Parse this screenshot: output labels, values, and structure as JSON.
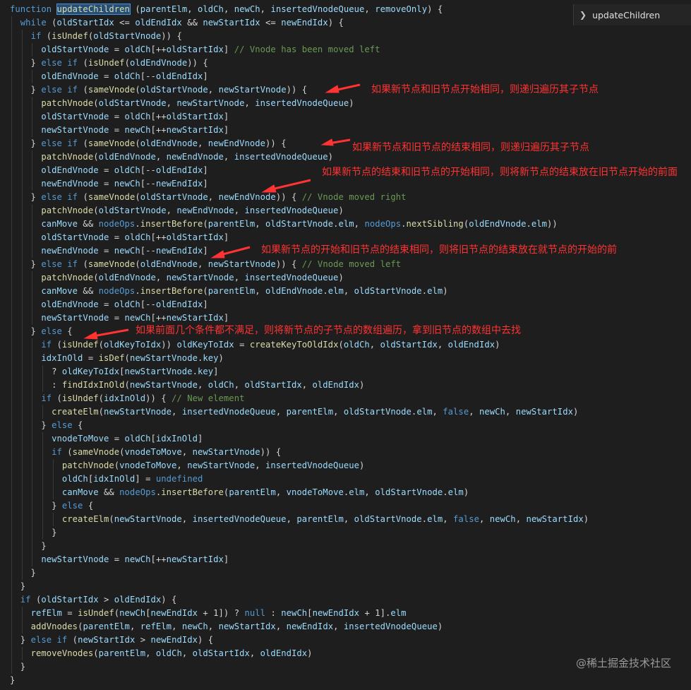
{
  "outline": {
    "label": "updateChildren"
  },
  "code": [
    "function updateChildren (parentElm, oldCh, newCh, insertedVnodeQueue, removeOnly) {",
    "  while (oldStartIdx <= oldEndIdx && newStartIdx <= newEndIdx) {",
    "    if (isUndef(oldStartVnode)) {",
    "      oldStartVnode = oldCh[++oldStartIdx] // Vnode has been moved left",
    "    } else if (isUndef(oldEndVnode)) {",
    "      oldEndVnode = oldCh[--oldEndIdx]",
    "    } else if (sameVnode(oldStartVnode, newStartVnode)) {",
    "      patchVnode(oldStartVnode, newStartVnode, insertedVnodeQueue)",
    "      oldStartVnode = oldCh[++oldStartIdx]",
    "      newStartVnode = newCh[++newStartIdx]",
    "    } else if (sameVnode(oldEndVnode, newEndVnode)) {",
    "      patchVnode(oldEndVnode, newEndVnode, insertedVnodeQueue)",
    "      oldEndVnode = oldCh[--oldEndIdx]",
    "      newEndVnode = newCh[--newEndIdx]",
    "    } else if (sameVnode(oldStartVnode, newEndVnode)) { // Vnode moved right",
    "      patchVnode(oldStartVnode, newEndVnode, insertedVnodeQueue)",
    "      canMove && nodeOps.insertBefore(parentElm, oldStartVnode.elm, nodeOps.nextSibling(oldEndVnode.elm))",
    "      oldStartVnode = oldCh[++oldStartIdx]",
    "      newEndVnode = newCh[--newEndIdx]",
    "    } else if (sameVnode(oldEndVnode, newStartVnode)) { // Vnode moved left",
    "      patchVnode(oldEndVnode, newStartVnode, insertedVnodeQueue)",
    "      canMove && nodeOps.insertBefore(parentElm, oldEndVnode.elm, oldStartVnode.elm)",
    "      oldEndVnode = oldCh[--oldEndIdx]",
    "      newStartVnode = newCh[++newStartIdx]",
    "    } else {",
    "      if (isUndef(oldKeyToIdx)) oldKeyToIdx = createKeyToOldIdx(oldCh, oldStartIdx, oldEndIdx)",
    "      idxInOld = isDef(newStartVnode.key)",
    "        ? oldKeyToIdx[newStartVnode.key]",
    "        : findIdxInOld(newStartVnode, oldCh, oldStartIdx, oldEndIdx)",
    "      if (isUndef(idxInOld)) { // New element",
    "        createElm(newStartVnode, insertedVnodeQueue, parentElm, oldStartVnode.elm, false, newCh, newStartIdx)",
    "      } else {",
    "        vnodeToMove = oldCh[idxInOld]",
    "        if (sameVnode(vnodeToMove, newStartVnode)) {",
    "          patchVnode(vnodeToMove, newStartVnode, insertedVnodeQueue)",
    "          oldCh[idxInOld] = undefined",
    "          canMove && nodeOps.insertBefore(parentElm, vnodeToMove.elm, oldStartVnode.elm)",
    "        } else {",
    "          createElm(newStartVnode, insertedVnodeQueue, parentElm, oldStartVnode.elm, false, newCh, newStartIdx)",
    "        }",
    "      }",
    "      newStartVnode = newCh[++newStartIdx]",
    "    }",
    "  }",
    "  if (oldStartIdx > oldEndIdx) {",
    "    refElm = isUndef(newCh[newEndIdx + 1]) ? null : newCh[newEndIdx + 1].elm",
    "    addVnodes(parentElm, refElm, newCh, newStartIdx, newEndIdx, insertedVnodeQueue)",
    "  } else if (newStartIdx > newEndIdx) {",
    "    removeVnodes(parentElm, oldCh, oldStartIdx, oldEndIdx)",
    "  }",
    "}"
  ],
  "annotations": [
    {
      "text": "如果新节点和旧节点开始相同，则递归遍历其子节点"
    },
    {
      "text": "如果新节点和旧节点的结束相同，则递归遍历其子节点"
    },
    {
      "text": "如果新节点的结束和旧节点的开始相同，则将新节点的结束放在旧节点开始的前面"
    },
    {
      "text": "如果新节点的开始和旧节点的结束相同，则将旧节点的结束放在就节点的开始的前"
    },
    {
      "text": "如果前面几个条件都不满足，则将新节点的子节点的数组遍历，拿到旧节点的数组中去找"
    }
  ],
  "colors": {
    "background": "#1e1e1e",
    "keyword": "#569cd6",
    "function": "#dcdcaa",
    "variable": "#9cdcfe",
    "comment": "#6a9955",
    "annotation": "#ff3333"
  },
  "watermark": "@稀土掘金技术社区"
}
